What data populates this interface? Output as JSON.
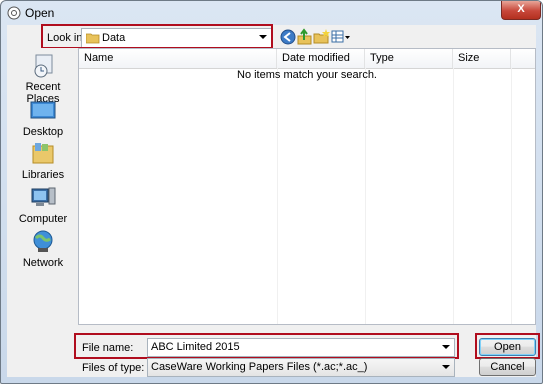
{
  "window": {
    "title": "Open",
    "close_label": "X"
  },
  "toolbar": {
    "look_in_label": "Look in:",
    "look_in_value": "Data",
    "back_icon": "back-arrow-icon",
    "up_icon": "up-folder-icon",
    "new_folder_icon": "new-folder-icon",
    "views_icon": "views-menu-icon"
  },
  "places": [
    {
      "label": "Recent Places",
      "icon": "recent-places-icon"
    },
    {
      "label": "Desktop",
      "icon": "desktop-icon"
    },
    {
      "label": "Libraries",
      "icon": "libraries-icon"
    },
    {
      "label": "Computer",
      "icon": "computer-icon"
    },
    {
      "label": "Network",
      "icon": "network-icon"
    }
  ],
  "list": {
    "columns": [
      "Name",
      "Date modified",
      "Type",
      "Size"
    ],
    "empty_message": "No items match your search."
  },
  "form": {
    "file_name_label": "File name:",
    "file_name_value": "ABC Limited 2015",
    "file_type_label": "Files of type:",
    "file_type_value": "CaseWare Working Papers Files (*.ac;*.ac_)"
  },
  "buttons": {
    "open": "Open",
    "cancel": "Cancel"
  },
  "colors": {
    "highlight": "#b00d1e",
    "close_button": "#c7473a"
  }
}
